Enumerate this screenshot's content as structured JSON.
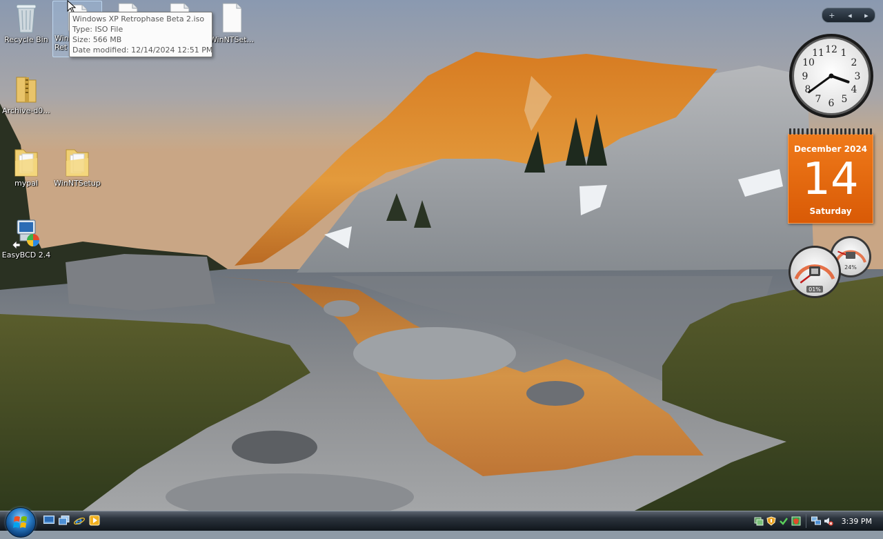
{
  "desktop": {
    "icons": [
      {
        "label": "Recycle Bin"
      },
      {
        "label": "Win...\nRet..."
      },
      {
        "label": ""
      },
      {
        "label": ""
      },
      {
        "label": "WinNTSet..."
      },
      {
        "label": "Archive-d0..."
      },
      {
        "label": "mypal"
      },
      {
        "label": "WinNTSetup"
      },
      {
        "label": "EasyBCD 2.4"
      }
    ],
    "selected_icon_label": "Win\nRet"
  },
  "tooltip": {
    "name": "Windows XP Retrophase Beta 2.iso",
    "type": "Type: ISO File",
    "size": "Size: 566 MB",
    "modified": "Date modified: 12/14/2024 12:51 PM"
  },
  "gadgets": {
    "toolbar": {
      "add": "+",
      "prev": "◂",
      "next": "▸"
    },
    "clock": {
      "hour": 3,
      "minute": 39
    },
    "calendar": {
      "month": "December 2024",
      "day": "14",
      "weekday": "Saturday"
    },
    "meter": {
      "cpu": "01%",
      "memory": "24%",
      "cpu_value": 1,
      "memory_value": 24
    }
  },
  "taskbar": {
    "quick_launch": [
      "show-desktop-icon",
      "switch-windows-icon",
      "internet-explorer-icon",
      "media-player-icon"
    ],
    "tray_icons": [
      "network-status-icon",
      "security-shield-icon",
      "windows-update-icon",
      "defender-icon",
      "network-icon",
      "volume-muted-icon"
    ],
    "time": "3:39 PM"
  }
}
